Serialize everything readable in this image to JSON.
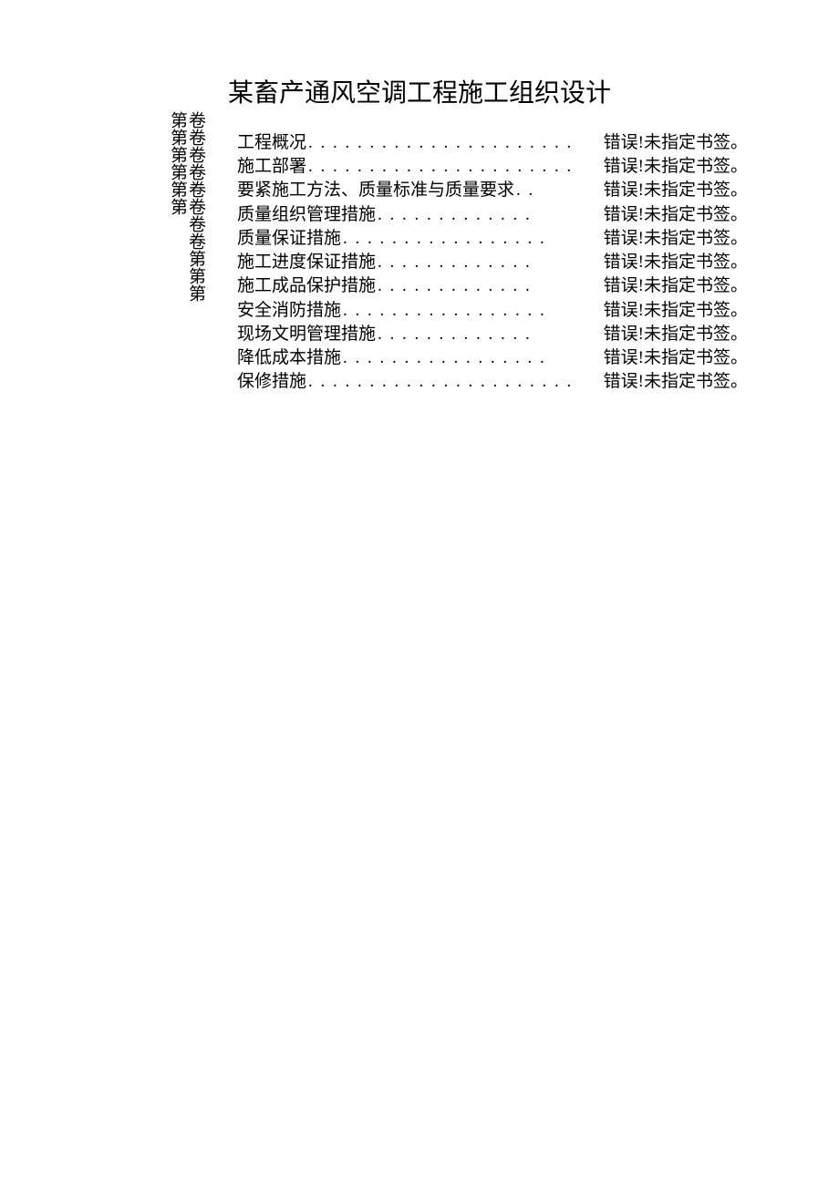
{
  "title": "某畜产通风空调工程施工组织设计",
  "vertical_columns": {
    "col1": "卷卷卷卷卷卷卷卷第第第",
    "col2": "第第第第第第"
  },
  "toc": [
    {
      "label": "工程概况",
      "dots": ". . . . . . . . . . . . . . . . . . . . . .",
      "page": "错误!未指定书签。"
    },
    {
      "label": "施工部署",
      "dots": ". . . . . . . . . . . . . . . . . . . . . .",
      "page": "错误!未指定书签。"
    },
    {
      "label": "要紧施工方法、质量标准与质量要求",
      "dots": ". .",
      "page": "错误!未指定书签。"
    },
    {
      "label": "质量组织管理措施",
      "dots": ". . . . . . . . . . . . .",
      "page": "错误!未指定书签。"
    },
    {
      "label": "质量保证措施",
      "dots": ". . . . . . . . . . . . . . . . .",
      "page": "错误!未指定书签。"
    },
    {
      "label": "施工进度保证措施",
      "dots": ". . . . . . . . . . . . .",
      "page": "错误!未指定书签。"
    },
    {
      "label": "施工成品保护措施",
      "dots": ". . . . . . . . . . . . .",
      "page": "错误!未指定书签。"
    },
    {
      "label": "安全消防措施",
      "dots": ". . . . . . . . . . . . . . . . .",
      "page": "错误!未指定书签。"
    },
    {
      "label": "现场文明管理措施",
      "dots": ". . . . . . . . . . . . .",
      "page": "错误!未指定书签。"
    },
    {
      "label": "降低成本措施",
      "dots": ". . . . . . . . . . . . . . . . .",
      "page": "错误!未指定书签。"
    },
    {
      "label": "保修措施",
      "dots": ". . . . . . . . . . . . . . . . . . . . . .",
      "page": "错误!未指定书签。"
    }
  ]
}
